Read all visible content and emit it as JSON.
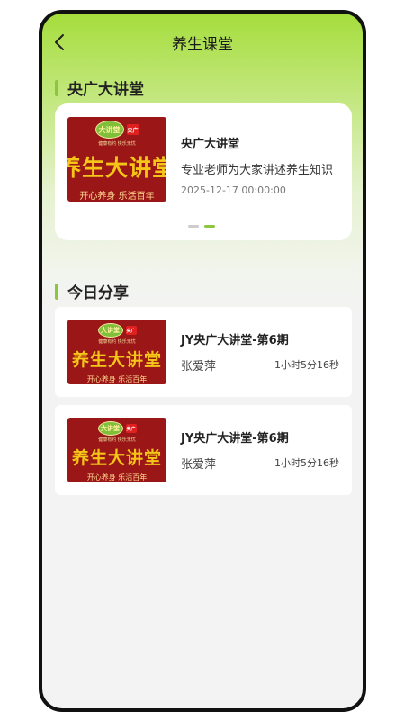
{
  "header": {
    "title": "养生课堂",
    "back_icon": "chevron-left-icon"
  },
  "section1": {
    "title": "央广大讲堂"
  },
  "banner": {
    "name": "央广大讲堂",
    "description": "专业老师为大家讲述养生知识",
    "date": "2025-12-17 00:00:00",
    "poster": {
      "logo_left": "大讲堂",
      "logo_right": "央广",
      "tagline": "健康有约 快乐无忧",
      "title": "养生大讲堂",
      "slogan": "开心养身 乐活百年"
    },
    "carousel": {
      "total": 2,
      "active_index": 1
    }
  },
  "section2": {
    "title": "今日分享"
  },
  "items": [
    {
      "title": "JY央广大讲堂-第6期",
      "author": "张爱萍",
      "duration": "1小时5分16秒",
      "poster": {
        "logo_left": "大讲堂",
        "logo_right": "央广",
        "tagline": "健康有约 快乐无忧",
        "title": "养生大讲堂",
        "slogan": "开心养身 乐活百年"
      }
    },
    {
      "title": "JY央广大讲堂-第6期",
      "author": "张爱萍",
      "duration": "1小时5分16秒",
      "poster": {
        "logo_left": "大讲堂",
        "logo_right": "央广",
        "tagline": "健康有约 快乐无忧",
        "title": "养生大讲堂",
        "slogan": "开心养身 乐活百年"
      }
    }
  ],
  "colors": {
    "accent": "#8cc63f",
    "header_green": "#a5dd3c",
    "poster_red": "#9b1717",
    "poster_gold": "#f5c518"
  }
}
